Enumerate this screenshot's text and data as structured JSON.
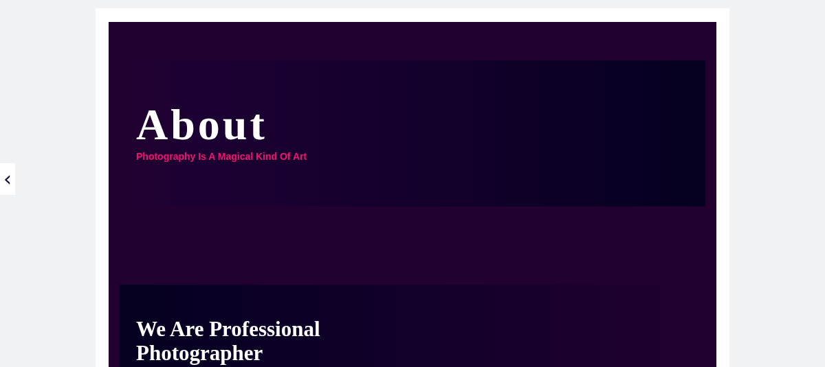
{
  "back_button": {
    "label": "‹"
  },
  "hero": {
    "title": "About",
    "subtitle": "Photography Is A Magical Kind Of Art"
  },
  "section": {
    "heading": "We Are Professional Photographer"
  }
}
